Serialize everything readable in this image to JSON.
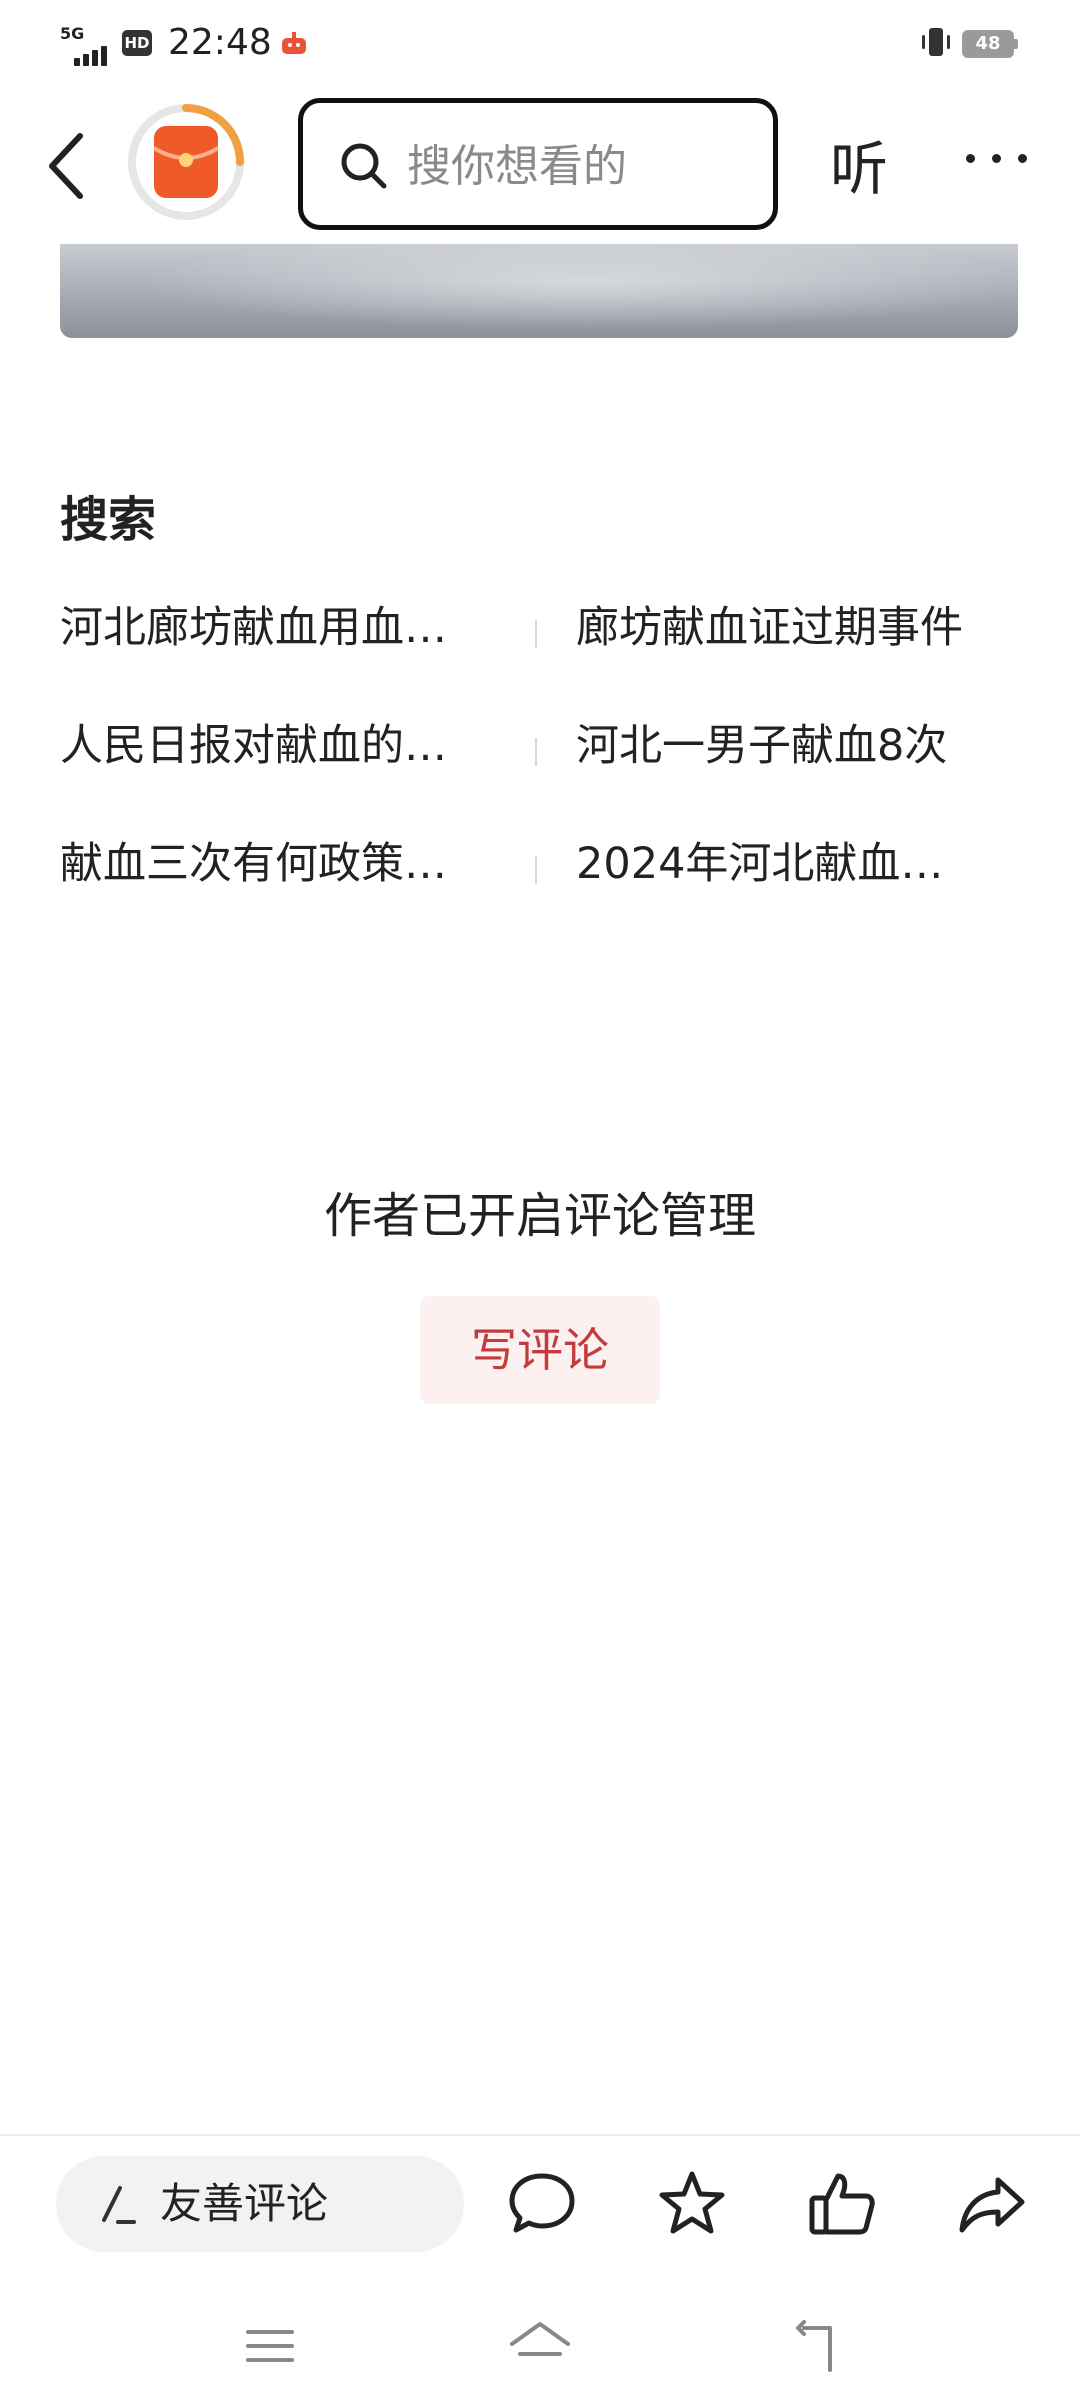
{
  "status_bar": {
    "network": "5G",
    "hd_badge": "HD",
    "time": "22:48",
    "battery": "48"
  },
  "top_bar": {
    "search_placeholder": "搜你想看的",
    "listen_label": "听"
  },
  "search_section": {
    "title": "搜索",
    "suggestions": [
      {
        "left": "河北廊坊献血用血…",
        "right": "廊坊献血证过期事件"
      },
      {
        "left": "人民日报对献血的…",
        "right": "河北一男子献血8次"
      },
      {
        "left": "献血三次有何政策…",
        "right": "2024年河北献血…"
      }
    ]
  },
  "comments": {
    "notice": "作者已开启评论管理",
    "write_button": "写评论"
  },
  "bottom_bar": {
    "comment_placeholder": "友善评论"
  },
  "colors": {
    "accent_red": "#c43b3b",
    "write_button_bg": "#fdf0f0",
    "avatar_ring": "#f0a040",
    "avatar_fill": "#f05a28"
  }
}
